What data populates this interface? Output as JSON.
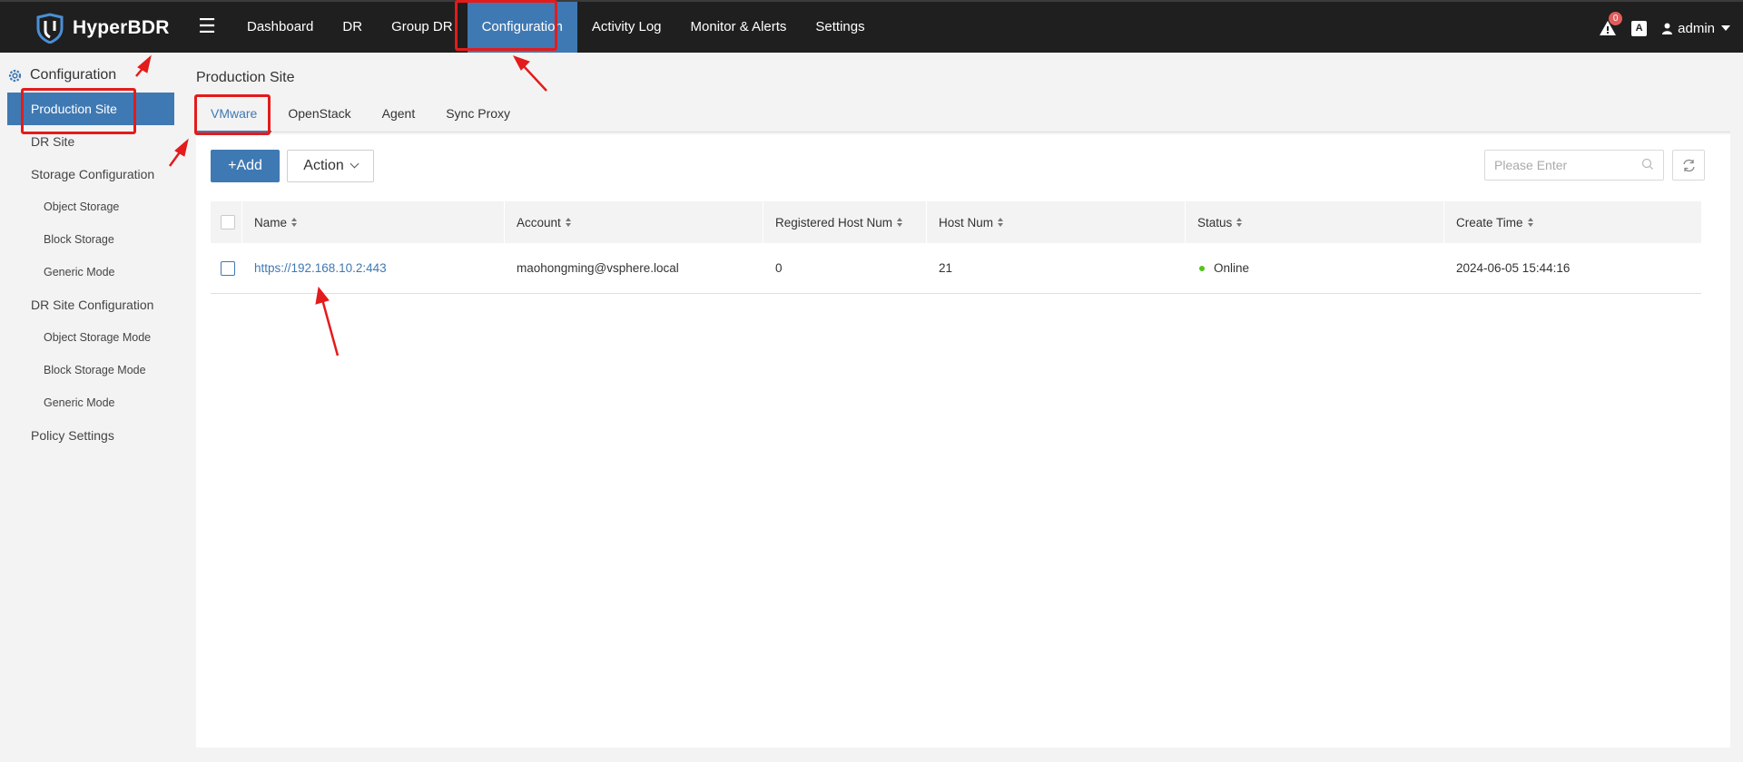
{
  "app": {
    "name": "HyperBDR"
  },
  "topnav": {
    "items": [
      {
        "label": "Dashboard",
        "active": false
      },
      {
        "label": "DR",
        "active": false
      },
      {
        "label": "Group DR",
        "active": false
      },
      {
        "label": "Configuration",
        "active": true
      },
      {
        "label": "Activity Log",
        "active": false
      },
      {
        "label": "Monitor & Alerts",
        "active": false
      },
      {
        "label": "Settings",
        "active": false
      }
    ],
    "alert_count": "0",
    "lang_icon": "A",
    "user": "admin"
  },
  "sidebar": {
    "heading": "Configuration",
    "items": [
      {
        "label": "Production Site",
        "active": true,
        "level": 1
      },
      {
        "label": "DR Site",
        "active": false,
        "level": 1
      },
      {
        "label": "Storage Configuration",
        "active": false,
        "level": 1
      },
      {
        "label": "Object Storage",
        "active": false,
        "level": 2
      },
      {
        "label": "Block Storage",
        "active": false,
        "level": 2
      },
      {
        "label": "Generic Mode",
        "active": false,
        "level": 2
      },
      {
        "label": "DR Site Configuration",
        "active": false,
        "level": 1
      },
      {
        "label": "Object Storage Mode",
        "active": false,
        "level": 2
      },
      {
        "label": "Block Storage Mode",
        "active": false,
        "level": 2
      },
      {
        "label": "Generic Mode",
        "active": false,
        "level": 2
      },
      {
        "label": "Policy Settings",
        "active": false,
        "level": 1
      }
    ]
  },
  "main": {
    "title": "Production Site",
    "tabs": [
      {
        "label": "VMware",
        "active": true
      },
      {
        "label": "OpenStack",
        "active": false
      },
      {
        "label": "Agent",
        "active": false
      },
      {
        "label": "Sync Proxy",
        "active": false
      }
    ],
    "toolbar": {
      "add_label": "+Add",
      "action_label": "Action",
      "search_placeholder": "Please Enter"
    },
    "table": {
      "columns": [
        "Name",
        "Account",
        "Registered Host Num",
        "Host Num",
        "Status",
        "Create Time"
      ],
      "rows": [
        {
          "name": "https://192.168.10.2:443",
          "account": "maohongming@vsphere.local",
          "registered_host_num": "0",
          "host_num": "21",
          "status": "Online",
          "create_time": "2024-06-05 15:44:16"
        }
      ]
    }
  },
  "colors": {
    "topbar": "#1f1f1f",
    "accent": "#3f79b3",
    "status_online": "#52c41a",
    "annotation": "#e41b1b"
  }
}
